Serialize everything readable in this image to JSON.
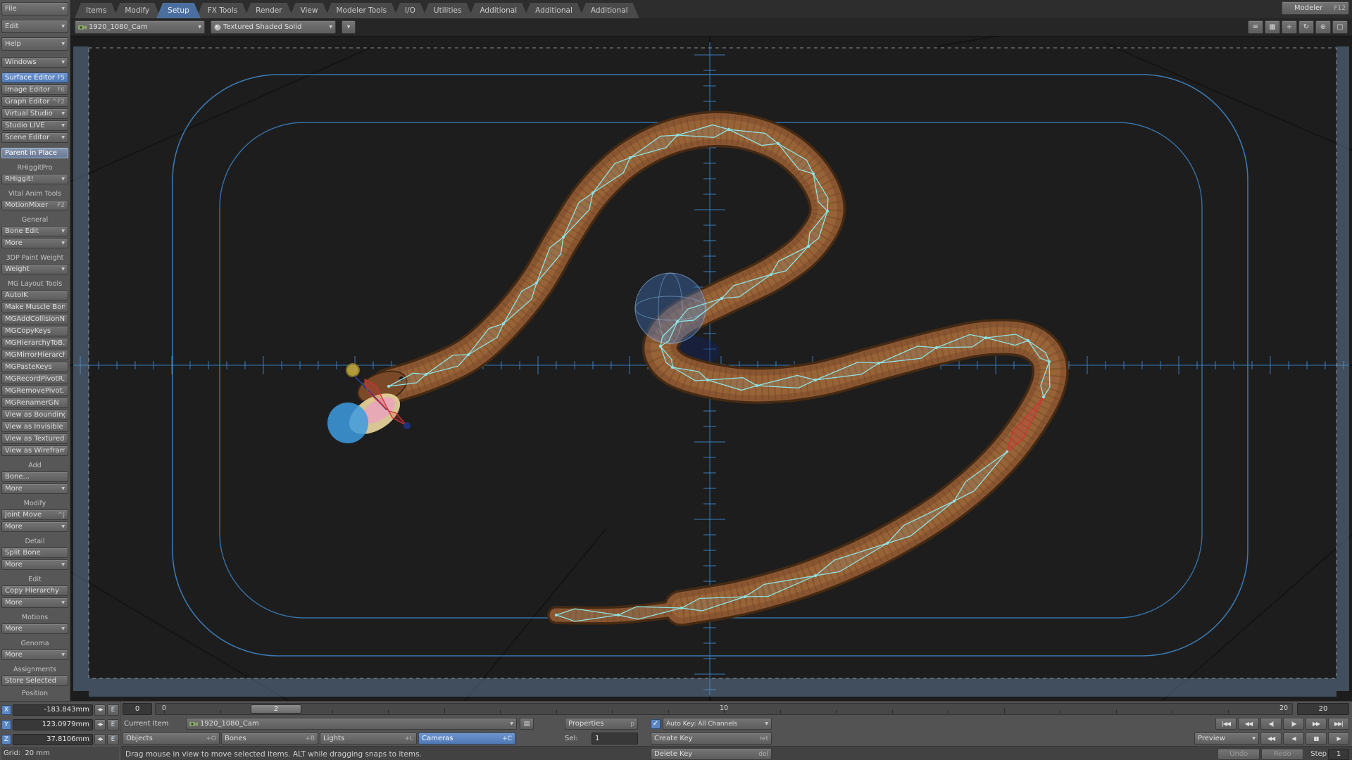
{
  "menubar": {
    "file": {
      "label": "File"
    },
    "edit": {
      "label": "Edit"
    },
    "help": {
      "label": "Help"
    },
    "tabs": [
      {
        "label": "Items",
        "active": false
      },
      {
        "label": "Modify",
        "active": false
      },
      {
        "label": "Setup",
        "active": true
      },
      {
        "label": "FX Tools",
        "active": false
      },
      {
        "label": "Render",
        "active": false
      },
      {
        "label": "View",
        "active": false
      },
      {
        "label": "Modeler Tools",
        "active": false
      },
      {
        "label": "I/O",
        "active": false
      },
      {
        "label": "Utilities",
        "active": false
      },
      {
        "label": "Additional",
        "active": false
      },
      {
        "label": "Additional",
        "active": false
      },
      {
        "label": "Additional",
        "active": false
      }
    ],
    "modeler_button": "Modeler",
    "modeler_key": "F12"
  },
  "viewport_toolbar": {
    "camera_name": "1920_1080_Cam",
    "shading_mode": "Textured Shaded Solid",
    "icons": [
      "menu-icon",
      "panes-icon",
      "pan-icon",
      "rotate-icon",
      "zoom-icon",
      "maximize-icon"
    ]
  },
  "sidebar": {
    "items": [
      {
        "type": "dropdown",
        "label": "Windows"
      },
      {
        "type": "gap"
      },
      {
        "type": "button",
        "label": "Surface Editor",
        "key": "F5",
        "active": true
      },
      {
        "type": "button",
        "label": "Image Editor",
        "key": "F6"
      },
      {
        "type": "button",
        "label": "Graph Editor",
        "key": "^F2"
      },
      {
        "type": "dropdown",
        "label": "Virtual Studio"
      },
      {
        "type": "dropdown",
        "label": "Studio LIVE"
      },
      {
        "type": "dropdown",
        "label": "Scene Editor"
      },
      {
        "type": "gap"
      },
      {
        "type": "toggle",
        "label": "Parent in Place",
        "active": true
      },
      {
        "type": "gap"
      },
      {
        "type": "header",
        "label": "RHiggitPro"
      },
      {
        "type": "dropdown",
        "label": "RHiggit!"
      },
      {
        "type": "gap"
      },
      {
        "type": "header",
        "label": "Vital Anim Tools"
      },
      {
        "type": "button",
        "label": "MotionMixer",
        "key": "F2"
      },
      {
        "type": "gap"
      },
      {
        "type": "header",
        "label": "General"
      },
      {
        "type": "dropdown",
        "label": "Bone Edit"
      },
      {
        "type": "dropdown",
        "label": "More"
      },
      {
        "type": "gap"
      },
      {
        "type": "header",
        "label": "3DP Paint Weight"
      },
      {
        "type": "dropdown",
        "label": "Weight"
      },
      {
        "type": "gap"
      },
      {
        "type": "header",
        "label": "MG Layout Tools"
      },
      {
        "type": "button",
        "label": "AutoIK"
      },
      {
        "type": "button",
        "label": "Make Muscle Bone"
      },
      {
        "type": "button",
        "label": "MGAddCollisionN..."
      },
      {
        "type": "button",
        "label": "MGCopyKeys"
      },
      {
        "type": "button",
        "label": "MGHierarchyToB..."
      },
      {
        "type": "button",
        "label": "MGMirrorHierarch..."
      },
      {
        "type": "button",
        "label": "MGPasteKeys"
      },
      {
        "type": "button",
        "label": "MGRecordPivotR..."
      },
      {
        "type": "button",
        "label": "MGRemovePivot..."
      },
      {
        "type": "button",
        "label": "MGRenamerGN"
      },
      {
        "type": "button",
        "label": "View as Bounding..."
      },
      {
        "type": "button",
        "label": "View as Invisible"
      },
      {
        "type": "button",
        "label": "View as Textured"
      },
      {
        "type": "button",
        "label": "View as Wireframe"
      },
      {
        "type": "gap"
      },
      {
        "type": "header",
        "label": "Add"
      },
      {
        "type": "button",
        "label": "Bone..."
      },
      {
        "type": "dropdown",
        "label": "More"
      },
      {
        "type": "gap"
      },
      {
        "type": "header",
        "label": "Modify"
      },
      {
        "type": "button",
        "label": "Joint Move",
        "key": "^J"
      },
      {
        "type": "dropdown",
        "label": "More"
      },
      {
        "type": "gap"
      },
      {
        "type": "header",
        "label": "Detail"
      },
      {
        "type": "button",
        "label": "Split Bone"
      },
      {
        "type": "dropdown",
        "label": "More"
      },
      {
        "type": "gap"
      },
      {
        "type": "header",
        "label": "Edit"
      },
      {
        "type": "button",
        "label": "Copy Hierarchy"
      },
      {
        "type": "dropdown",
        "label": "More"
      },
      {
        "type": "gap"
      },
      {
        "type": "header",
        "label": "Motions"
      },
      {
        "type": "dropdown",
        "label": "More"
      },
      {
        "type": "gap"
      },
      {
        "type": "header",
        "label": "Genoma"
      },
      {
        "type": "dropdown",
        "label": "More"
      },
      {
        "type": "gap"
      },
      {
        "type": "header",
        "label": "Assignments"
      },
      {
        "type": "button",
        "label": "Store Selected"
      }
    ]
  },
  "bottom": {
    "position": {
      "header": "Position",
      "fields": [
        {
          "axis": "X",
          "value": "-183.843mm"
        },
        {
          "axis": "Y",
          "value": "123.0979mm"
        },
        {
          "axis": "Z",
          "value": "37.8106mm"
        }
      ],
      "envelope_label": "E"
    },
    "grid": {
      "label": "Grid:",
      "value": "20 mm"
    },
    "timeline": {
      "first_frame": "0",
      "last_frame": "20",
      "current_frame": "2",
      "frame_min": 0,
      "frame_max": 20,
      "labels": [
        0,
        10,
        20
      ]
    },
    "current_item": {
      "label": "Current Item",
      "value": "1920_1080_Cam"
    },
    "item_buttons": [
      {
        "label": "Objects",
        "key": "+O",
        "active": false
      },
      {
        "label": "Bones",
        "key": "+B",
        "active": false
      },
      {
        "label": "Lights",
        "key": "+L",
        "active": false
      },
      {
        "label": "Cameras",
        "key": "+C",
        "active": true
      }
    ],
    "properties": {
      "label": "Properties",
      "key": "p"
    },
    "selection": {
      "label": "Sel:",
      "value": "1"
    },
    "auto_key": {
      "checked": true,
      "label": "Auto Key: All Channels",
      "check_glyph": "✓"
    },
    "create_key": {
      "label": "Create Key",
      "key": "ret"
    },
    "delete_key": {
      "label": "Delete Key",
      "key": "del"
    },
    "status_text": "Drag mouse in view to move selected items. ALT while dragging snaps to items.",
    "transport": [
      "|◀◀",
      "◀◀",
      "◀|",
      "|▶",
      "▶▶",
      "▶▶|"
    ],
    "preview": {
      "label": "Preview",
      "buttons": [
        "◀◀",
        "◀",
        "▮▮",
        "▶"
      ]
    },
    "undo": "Undo",
    "redo": "Redo",
    "step": {
      "label": "Step",
      "value": "1"
    }
  },
  "viewport": {
    "bg": "#1d1d1d",
    "grid_color": "#3f87c8",
    "bone_color": "#8fe3e3",
    "selected_bone_color": "#cc3333",
    "snake_color": "#8a5632",
    "mask_color": "rgba(118,152,190,0.40)"
  }
}
